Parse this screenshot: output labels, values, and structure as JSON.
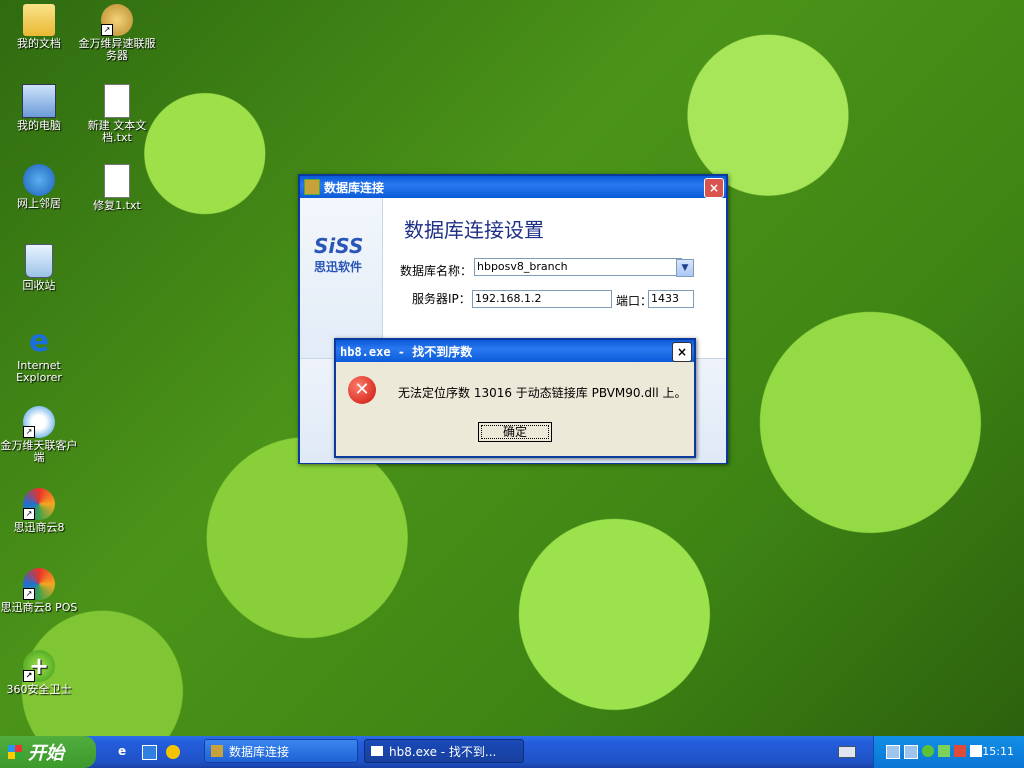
{
  "desktop": {
    "icons": [
      {
        "label": "我的文档"
      },
      {
        "label": "金万维异速联服务器"
      },
      {
        "label": "我的电脑"
      },
      {
        "label": "新建 文本文档.txt"
      },
      {
        "label": "网上邻居"
      },
      {
        "label": "修复1.txt"
      },
      {
        "label": "回收站"
      },
      {
        "label": "Internet Explorer"
      },
      {
        "label": "金万维天联客户端"
      },
      {
        "label": "思迅商云8"
      },
      {
        "label": "思迅商云8 POS"
      },
      {
        "label": "360安全卫士"
      }
    ]
  },
  "db_window": {
    "title": "数据库连接",
    "close": "×",
    "logo_top": "SiSS",
    "logo_bottom": "思迅软件",
    "heading": "数据库连接设置",
    "dbname_label": "数据库名称：",
    "dbname_value": "hbposv8_branch",
    "server_label": "服务器IP：",
    "server_value": "192.168.1.2",
    "port_label": "端口：",
    "port_value": "1433"
  },
  "error_dialog": {
    "title": "hb8.exe - 找不到序数",
    "close": "×",
    "message": "无法定位序数 13016 于动态链接库 PBVM90.dll 上。",
    "ok_label": "确定",
    "error_icon": "error-x-icon"
  },
  "taskbar": {
    "start_label": "开始",
    "tasks": [
      {
        "label": "数据库连接",
        "active": false
      },
      {
        "label": "hb8.exe - 找不到...",
        "active": true
      }
    ],
    "clock": "15:11"
  }
}
